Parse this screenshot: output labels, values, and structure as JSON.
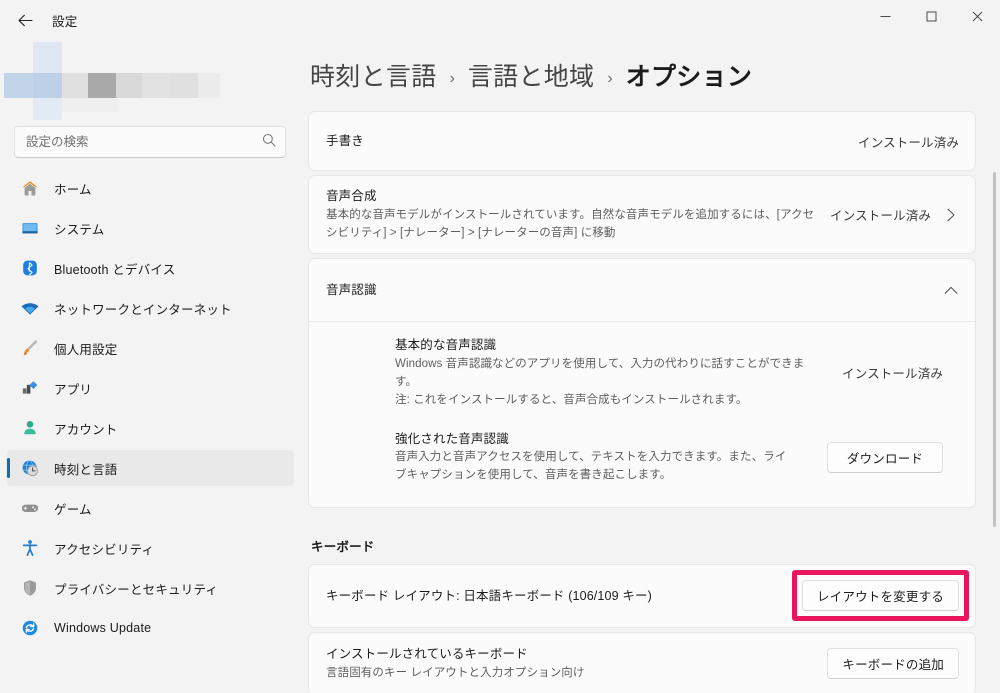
{
  "window": {
    "title": "設定",
    "back_tooltip": "戻る",
    "controls": {
      "minimize": "最小化",
      "maximize": "最大化",
      "close": "閉じる"
    }
  },
  "search": {
    "placeholder": "設定の検索",
    "value": "",
    "icon": "search-icon"
  },
  "sidebar": {
    "items": [
      {
        "label": "ホーム",
        "icon": "home-icon",
        "active": false
      },
      {
        "label": "システム",
        "icon": "monitor-icon",
        "active": false
      },
      {
        "label": "Bluetooth とデバイス",
        "icon": "bluetooth-icon",
        "active": false
      },
      {
        "label": "ネットワークとインターネット",
        "icon": "wifi-icon",
        "active": false
      },
      {
        "label": "個人用設定",
        "icon": "paintbrush-icon",
        "active": false
      },
      {
        "label": "アプリ",
        "icon": "apps-icon",
        "active": false
      },
      {
        "label": "アカウント",
        "icon": "account-icon",
        "active": false
      },
      {
        "label": "時刻と言語",
        "icon": "clock-globe-icon",
        "active": true
      },
      {
        "label": "ゲーム",
        "icon": "gamepad-icon",
        "active": false
      },
      {
        "label": "アクセシビリティ",
        "icon": "accessibility-icon",
        "active": false
      },
      {
        "label": "プライバシーとセキュリティ",
        "icon": "shield-icon",
        "active": false
      },
      {
        "label": "Windows Update",
        "icon": "update-icon",
        "active": false
      }
    ]
  },
  "breadcrumb": {
    "items": [
      "時刻と言語",
      "言語と地域",
      "オプション"
    ],
    "separator": "›"
  },
  "main": {
    "handwriting": {
      "title": "手書き",
      "status": "インストール済み"
    },
    "speech_synthesis": {
      "title": "音声合成",
      "description": "基本的な音声モデルがインストールされています。自然な音声モデルを追加するには、[アクセシビリティ] > [ナレーター] > [ナレーターの音声] に移動",
      "status": "インストール済み",
      "chevron": "chevron-right-icon"
    },
    "speech_recognition": {
      "title": "音声認識",
      "expanded": true,
      "chevron": "chevron-up-icon",
      "basic": {
        "title": "基本的な音声認識",
        "description": "Windows 音声認識などのアプリを使用して、入力の代わりに話すことができます。\n注: これをインストールすると、音声合成もインストールされます。",
        "status": "インストール済み"
      },
      "enhanced": {
        "title": "強化された音声認識",
        "description": "音声入力と音声アクセスを使用して、テキストを入力できます。また、ライブキャプションを使用して、音声を書き起こします。",
        "button": "ダウンロード"
      }
    },
    "keyboard": {
      "section_title": "キーボード",
      "layout_row": {
        "title": "キーボード レイアウト: 日本語キーボード (106/109 キー)",
        "button": "レイアウトを変更する",
        "highlighted": true,
        "highlight_color": "#e8175d"
      },
      "installed_row": {
        "title": "インストールされているキーボード",
        "description": "言語固有のキー レイアウトと入力オプション向け",
        "button": "キーボードの追加"
      }
    }
  },
  "colors": {
    "accent": "#0f6cbd",
    "page_bg": "#f3f3f3",
    "card_bg": "#fbfbfb",
    "highlight": "#e8175d"
  }
}
